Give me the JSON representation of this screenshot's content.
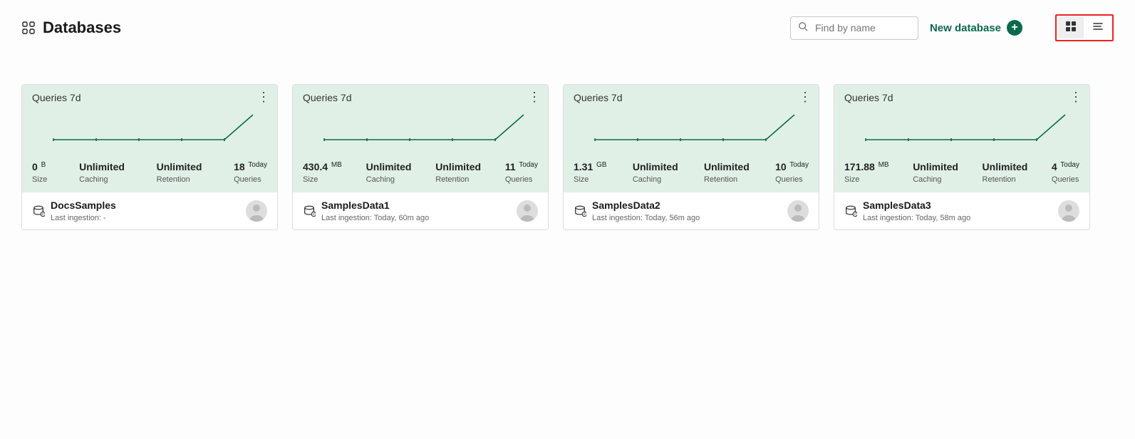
{
  "header": {
    "title": "Databases",
    "search_placeholder": "Find by name",
    "new_db_label": "New database"
  },
  "card_labels": {
    "queries": "Queries 7d",
    "size": "Size",
    "caching": "Caching",
    "retention": "Retention",
    "queries_col": "Queries"
  },
  "cards": [
    {
      "size_value": "0",
      "size_unit": "B",
      "caching": "Unlimited",
      "retention": "Unlimited",
      "queries_value": "18",
      "queries_unit": "Today",
      "name": "DocsSamples",
      "ingestion": "Last ingestion: -"
    },
    {
      "size_value": "430.4",
      "size_unit": "MB",
      "caching": "Unlimited",
      "retention": "Unlimited",
      "queries_value": "11",
      "queries_unit": "Today",
      "name": "SamplesData1",
      "ingestion": "Last ingestion: Today, 60m ago"
    },
    {
      "size_value": "1.31",
      "size_unit": "GB",
      "caching": "Unlimited",
      "retention": "Unlimited",
      "queries_value": "10",
      "queries_unit": "Today",
      "name": "SamplesData2",
      "ingestion": "Last ingestion: Today, 56m ago"
    },
    {
      "size_value": "171.88",
      "size_unit": "MB",
      "caching": "Unlimited",
      "retention": "Unlimited",
      "queries_value": "4",
      "queries_unit": "Today",
      "name": "SamplesData3",
      "ingestion": "Last ingestion: Today, 58m ago"
    }
  ]
}
